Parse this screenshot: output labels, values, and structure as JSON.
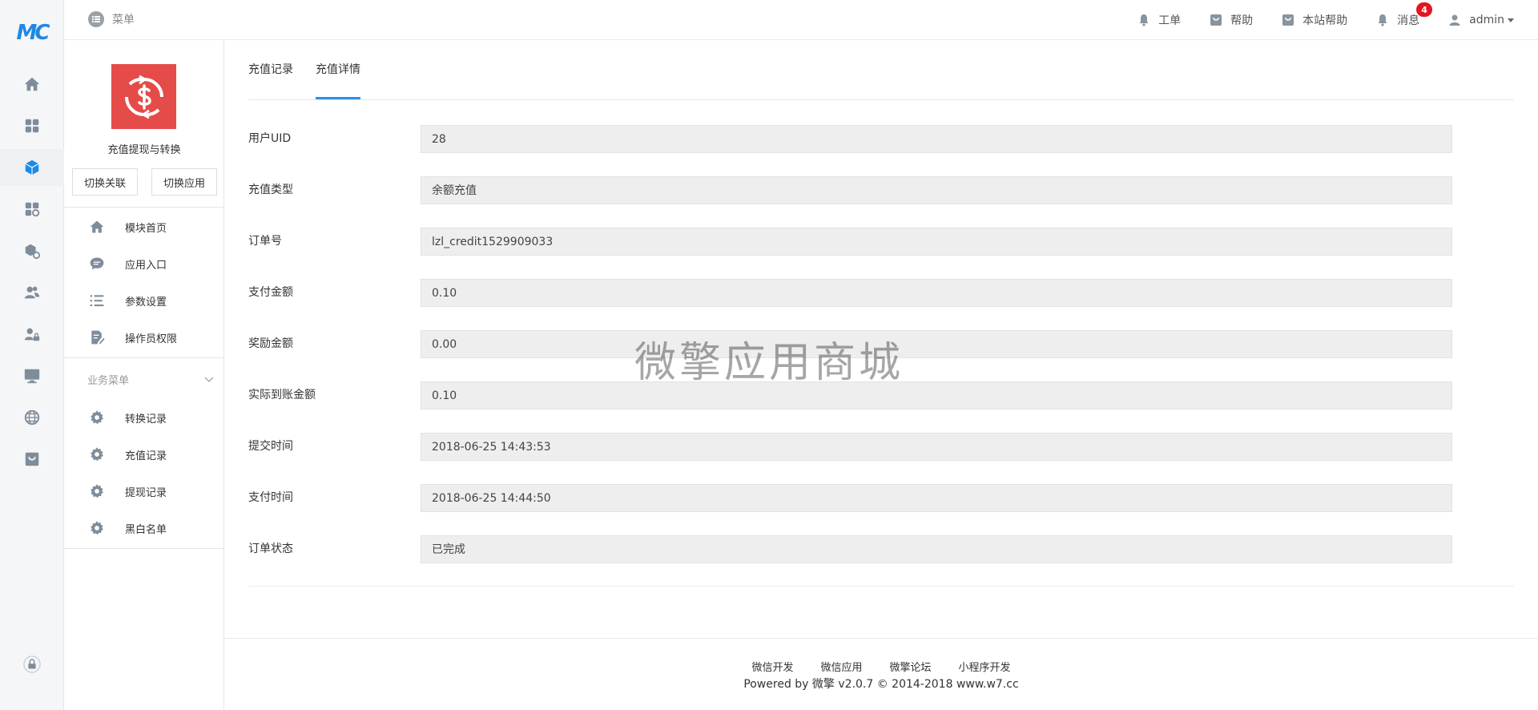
{
  "brand": {
    "logo_text": "MC"
  },
  "topbar": {
    "menu_label": "菜单",
    "nav": [
      {
        "label": "工单",
        "icon": "bell-icon"
      },
      {
        "label": "帮助",
        "icon": "shop-bag-icon"
      },
      {
        "label": "本站帮助",
        "icon": "shop-bag-icon"
      },
      {
        "label": "消息",
        "icon": "bell-icon",
        "badge": "4"
      }
    ],
    "user": {
      "name": "admin",
      "icon": "user-icon"
    }
  },
  "rail": {
    "icons": [
      "home-icon",
      "apps-grid-icon",
      "module-cube-icon",
      "apps-settings-icon",
      "cube-settings-icon",
      "users-icon",
      "user-lock-icon",
      "monitor-icon",
      "globe-icon",
      "shop-icon",
      "lock-icon"
    ],
    "active_index": 2
  },
  "sidebar": {
    "app_name": "充值提现与转换",
    "switch_link": "切换关联",
    "switch_app": "切换应用",
    "items": [
      {
        "label": "模块首页",
        "icon": "home-icon"
      },
      {
        "label": "应用入口",
        "icon": "chat-bubble-icon"
      },
      {
        "label": "参数设置",
        "icon": "list-settings-icon"
      },
      {
        "label": "操作员权限",
        "icon": "document-edit-icon"
      }
    ],
    "section_title": "业务菜单",
    "section_items": [
      {
        "label": "转换记录",
        "icon": "gear-icon"
      },
      {
        "label": "充值记录",
        "icon": "gear-icon"
      },
      {
        "label": "提现记录",
        "icon": "gear-icon"
      },
      {
        "label": "黑白名单",
        "icon": "gear-icon"
      }
    ]
  },
  "main": {
    "tabs": [
      {
        "label": "充值记录",
        "active": false
      },
      {
        "label": "充值详情",
        "active": true
      }
    ],
    "fields": [
      {
        "label": "用户UID",
        "value": "28"
      },
      {
        "label": "充值类型",
        "value": "余额充值"
      },
      {
        "label": "订单号",
        "value": "lzl_credit1529909033"
      },
      {
        "label": "支付金额",
        "value": "0.10"
      },
      {
        "label": "奖励金额",
        "value": "0.00"
      },
      {
        "label": "实际到账金额",
        "value": "0.10"
      },
      {
        "label": "提交时间",
        "value": "2018-06-25 14:43:53"
      },
      {
        "label": "支付时间",
        "value": "2018-06-25 14:44:50"
      },
      {
        "label": "订单状态",
        "value": "已完成"
      }
    ],
    "watermark": "微擎应用商城"
  },
  "footer": {
    "links": [
      "微信开发",
      "微信应用",
      "微擎论坛",
      "小程序开发"
    ],
    "copyright": "Powered by 微擎 v2.0.7 © 2014-2018 www.w7.cc"
  },
  "colors": {
    "accent": "#2f8ee8",
    "app_logo_bg": "#e54b48",
    "badge": "#e4151f",
    "rail_icon": "#7f8c99"
  }
}
